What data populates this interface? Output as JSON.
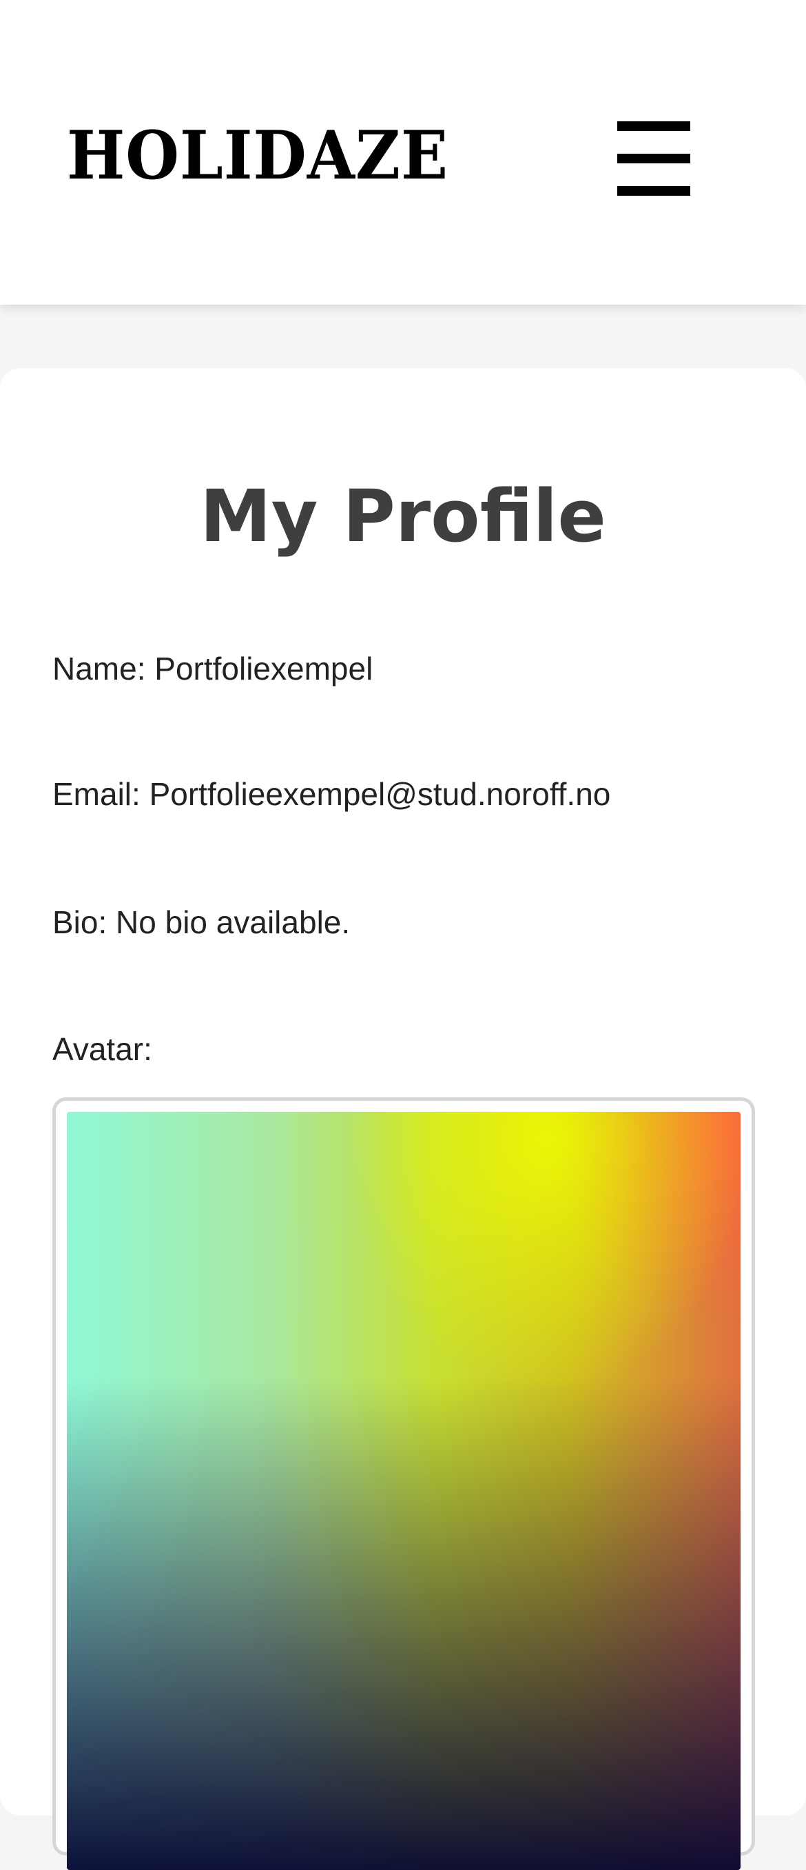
{
  "header": {
    "logo_text": "HOLIDAZE",
    "menu_icon": "hamburger-menu-icon"
  },
  "profile": {
    "title": "My Profile",
    "name_line": "Name: Portfoliexempel",
    "email_line": "Email: Portfolieexempel@stud.noroff.no",
    "bio_line": "Bio: No bio available.",
    "avatar_label": "Avatar:"
  },
  "colors": {
    "page_background": "#f5f5f5",
    "card_background": "#ffffff",
    "title_color": "#3f3f3f",
    "text_color": "#222222",
    "logo_color": "#000000"
  }
}
